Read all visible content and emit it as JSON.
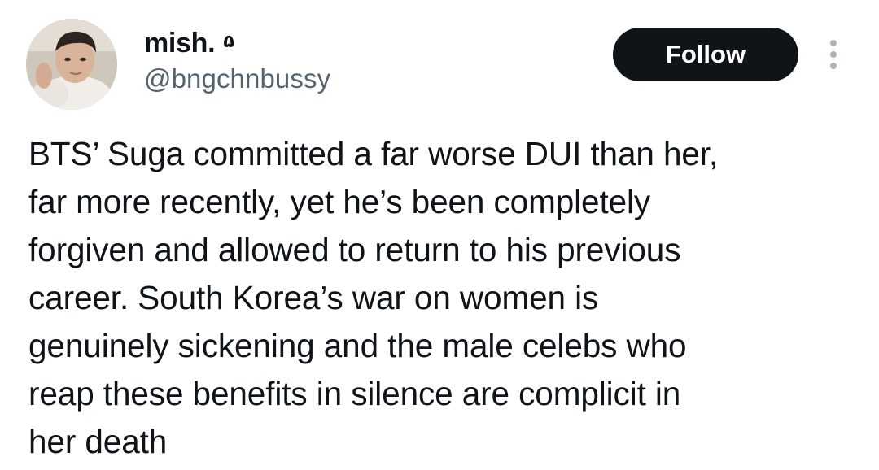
{
  "user": {
    "display_name": "mish.",
    "name_glyph": "۵",
    "handle": "@bngchnbussy"
  },
  "actions": {
    "follow_label": "Follow",
    "more_icon": "vertical-ellipsis"
  },
  "tweet": {
    "lines": [
      "BTS’ Suga committed a far worse DUI than her,",
      "far more recently, yet he’s been completely",
      "forgiven and allowed to return to his previous",
      "career. South Korea’s war on women is",
      "genuinely sickening and the male celebs who",
      "reap these benefits in silence are complicit in",
      "her death"
    ]
  },
  "colors": {
    "text": "#0f1419",
    "secondary": "#536471",
    "button_bg": "#0f1419",
    "button_text": "#ffffff",
    "icon_gray": "#aeb4b9"
  }
}
